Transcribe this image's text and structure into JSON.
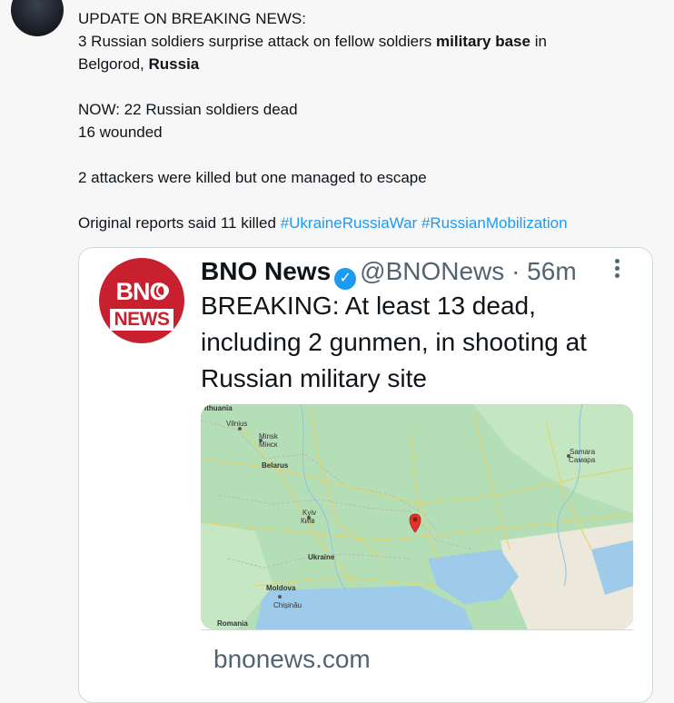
{
  "tweet": {
    "line1": "UPDATE ON BREAKING NEWS:",
    "line2_a": "3 Russian soldiers surprise attack on fellow soldiers ",
    "line2_b": "military base",
    "line2_c": " in",
    "line3_a": "Belgorod, ",
    "line3_b": "Russia",
    "line4": "NOW: 22 Russian soldiers dead",
    "line5": "16 wounded",
    "line6": "2 attackers were killed but one managed to escape",
    "line7_text": "Original reports said 11 killed ",
    "hashtag1": "#UkraineRussiaWar",
    "hashtag2": "#RussianMobilization"
  },
  "embedded": {
    "logo_top": "BNO",
    "logo_bottom": "NEWS",
    "name": "BNO News",
    "handle": "@BNONews",
    "dot": "·",
    "time": "56m",
    "text": "BREAKING: At least 13 dead, including 2 gunmen, in shooting at Russian military site",
    "link": "bnonews.com",
    "map_labels": {
      "lithuania": "ithuania",
      "vilnius": "Vilnius",
      "minsk": "Minsk",
      "minsk_local": "Мінск",
      "belarus": "Belarus",
      "kyiv": "Kyiv",
      "kyiv_local": "Київ",
      "ukraine": "Ukraine",
      "moldova": "Moldova",
      "chisinau": "Chișinău",
      "romania": "Romania",
      "samara": "Samara",
      "samara_local": "Самара"
    }
  },
  "colors": {
    "hashtag": "#1d9bf0",
    "logo_red": "#c8202f",
    "pin_red": "#e0312b"
  }
}
